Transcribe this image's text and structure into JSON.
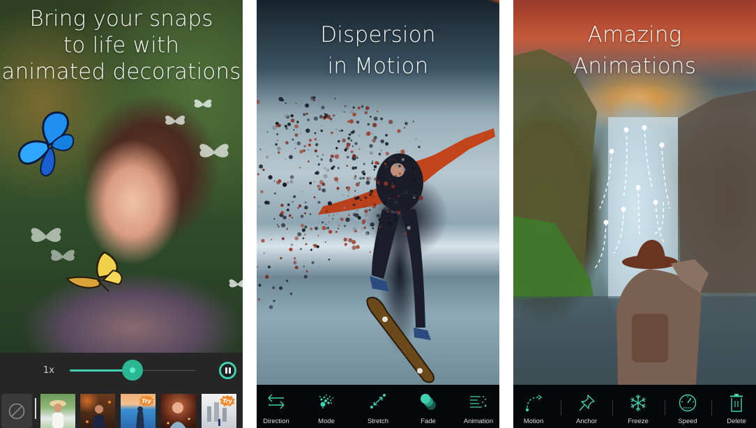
{
  "panels": [
    {
      "headline": [
        "Bring your snaps",
        "to life with",
        "animated decorations"
      ],
      "player": {
        "speed_label": "1x",
        "progress_percent": 50,
        "pause_icon": "pause-icon"
      },
      "thumbnails": [
        {
          "name": "girl-in-field",
          "badge": ""
        },
        {
          "name": "autumn-portrait",
          "badge": ""
        },
        {
          "name": "blue-paint-silhouette",
          "badge": "Try"
        },
        {
          "name": "sparkle-portrait",
          "badge": ""
        },
        {
          "name": "sketch-city",
          "badge": "Try"
        }
      ],
      "none_icon": "no-effect-icon"
    },
    {
      "headline": [
        "Dispersion",
        "in Motion"
      ],
      "tools": [
        {
          "label": "Direction",
          "icon": "direction-arrows-icon"
        },
        {
          "label": "Mode",
          "icon": "dispersion-mode-icon"
        },
        {
          "label": "Stretch",
          "icon": "stretch-icon"
        },
        {
          "label": "Fade",
          "icon": "fade-circles-icon"
        },
        {
          "label": "Animation",
          "icon": "animation-lines-icon"
        }
      ]
    },
    {
      "headline": [
        "Amazing",
        "Animations"
      ],
      "tools": [
        {
          "label": "Motion",
          "icon": "motion-path-icon"
        },
        {
          "label": "Anchor",
          "icon": "pin-icon"
        },
        {
          "label": "Freeze",
          "icon": "snowflake-icon"
        },
        {
          "label": "Speed",
          "icon": "speedometer-icon"
        },
        {
          "label": "Delete",
          "icon": "trash-icon"
        }
      ]
    }
  ],
  "colors": {
    "accent": "#3fd2b0",
    "accent_dark": "#2ab894",
    "toolbar_dark": "#050708",
    "player_bg": "#262626",
    "try_badge": "#f08a2e"
  }
}
